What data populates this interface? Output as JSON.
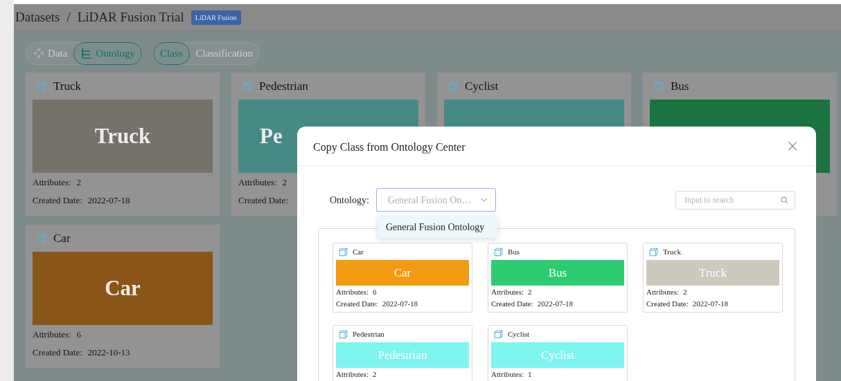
{
  "header": {
    "breadcrumb": [
      {
        "label": "Datasets"
      },
      {
        "label": "/"
      },
      {
        "label": "LiDAR Fusion Trial"
      }
    ],
    "tag": "LiDAR Fusion"
  },
  "view_tabs": [
    {
      "label": "Data",
      "selected": false
    },
    {
      "label": "Ontology",
      "selected": true
    }
  ],
  "type_tabs": [
    {
      "label": "Class",
      "selected": true
    },
    {
      "label": "Classification",
      "selected": false
    }
  ],
  "classes": [
    {
      "name": "Truck",
      "color": "#75726a",
      "image_label": "Truck",
      "lines": [
        {
          "label": "Attributes:",
          "value": "2"
        },
        {
          "label": "Created Date:",
          "value": "2022-07-18"
        }
      ]
    },
    {
      "name": "Pedestrian",
      "color": "#468a86",
      "image_label": "Pe",
      "cut": true,
      "lines": [
        {
          "label": "Attributes:",
          "value": "2"
        },
        {
          "label": "Created Date:"
        }
      ]
    },
    {
      "name": "Cyclist",
      "color": "#468a86"
    },
    {
      "name": "Bus",
      "color": "#1b7340"
    },
    {
      "name": "Car",
      "color": "#8a5618",
      "image_label": "Car",
      "lines": [
        {
          "label": "Attributes:",
          "value": "6"
        },
        {
          "label": "Created Date:",
          "value": "2022-10-13"
        }
      ]
    }
  ],
  "modal": {
    "title": "Copy Class from Ontology Center",
    "close": "×",
    "ontology_label": "Ontology:",
    "ontology_value": "General Fusion On…",
    "options": [
      {
        "label": "General Fusion Ontology",
        "selected": false
      }
    ],
    "search": {
      "placeholder": "Input to search"
    },
    "classes": [
      {
        "name": "Car",
        "color": "#f39c12",
        "image_label": "Car",
        "lines": [
          {
            "label": "Attributes:",
            "value": "6"
          },
          {
            "label": "Created Date:",
            "value": "2022-07-18"
          }
        ]
      },
      {
        "name": "Bus",
        "color": "#2ecc71",
        "image_label": "Bus",
        "lines": [
          {
            "label": "Attributes:",
            "value": "2"
          },
          {
            "label": "Created Date:",
            "value": "2022-07-18"
          }
        ]
      },
      {
        "name": "Truck",
        "color": "#cdc9bc",
        "image_label": "Truck",
        "lines": [
          {
            "label": "Attributes:",
            "value": "2"
          },
          {
            "label": "Created Date:",
            "value": "2022-07-18"
          }
        ]
      },
      {
        "name": "Pedestrian",
        "color": "#7ff5ef",
        "image_label": "Pedestrian",
        "lines": [
          {
            "label": "Attributes:",
            "value": "2"
          }
        ]
      },
      {
        "name": "Cyclist",
        "color": "#7ff5ef",
        "image_label": "Cyclist",
        "lines": [
          {
            "label": "Attributes:",
            "value": "1"
          }
        ]
      }
    ]
  }
}
